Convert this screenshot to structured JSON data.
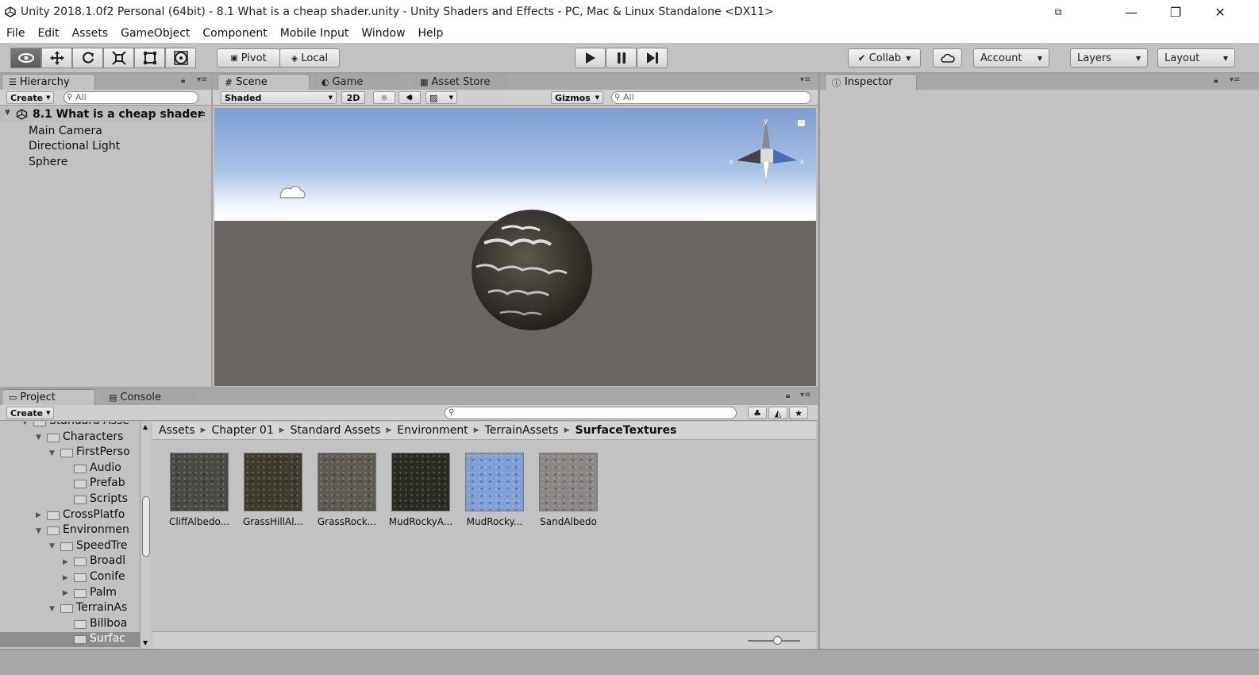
{
  "window": {
    "title": "Unity 2018.1.0f2 Personal (64bit) - 8.1 What is a cheap shader.unity - Unity Shaders and Effects - PC, Mac & Linux Standalone <DX11>",
    "minimize": "—",
    "maximize": "❐",
    "close": "✕"
  },
  "menu": [
    "File",
    "Edit",
    "Assets",
    "GameObject",
    "Component",
    "Mobile Input",
    "Window",
    "Help"
  ],
  "toolbar": {
    "pivot": "Pivot",
    "local": "Local",
    "collab": "Collab",
    "account": "Account",
    "layers": "Layers",
    "layout": "Layout"
  },
  "hierarchy": {
    "tab": "Hierarchy",
    "create": "Create",
    "search": "All",
    "scene": "8.1 What is a cheap shader",
    "items": [
      "Main Camera",
      "Directional Light",
      "Sphere"
    ]
  },
  "scene_panel": {
    "tabs": [
      "Scene",
      "Game",
      "Asset Store"
    ],
    "shading": "Shaded",
    "mode2d": "2D",
    "gizmos": "Gizmos",
    "search": "All",
    "gizmo_labels": {
      "x": "x",
      "y": "y",
      "z": "z"
    }
  },
  "inspector": {
    "tab": "Inspector"
  },
  "project": {
    "tabs": [
      "Project",
      "Console"
    ],
    "create": "Create",
    "tree": [
      {
        "label": "Standard Asse",
        "indent": 0,
        "open": true
      },
      {
        "label": "Characters",
        "indent": 1,
        "open": true
      },
      {
        "label": "FirstPerso",
        "indent": 2,
        "open": true
      },
      {
        "label": "Audio",
        "indent": 3,
        "open": null
      },
      {
        "label": "Prefab",
        "indent": 3,
        "open": null
      },
      {
        "label": "Scripts",
        "indent": 3,
        "open": null
      },
      {
        "label": "CrossPlatfo",
        "indent": 1,
        "open": false
      },
      {
        "label": "Environmen",
        "indent": 1,
        "open": true
      },
      {
        "label": "SpeedTre",
        "indent": 2,
        "open": true
      },
      {
        "label": "Broadl",
        "indent": 3,
        "open": false
      },
      {
        "label": "Conife",
        "indent": 3,
        "open": false
      },
      {
        "label": "Palm",
        "indent": 3,
        "open": false
      },
      {
        "label": "TerrainAs",
        "indent": 2,
        "open": true
      },
      {
        "label": "Billboa",
        "indent": 3,
        "open": null
      },
      {
        "label": "Surfac",
        "indent": 3,
        "open": null,
        "selected": true
      }
    ],
    "breadcrumb": [
      "Assets",
      "Chapter 01",
      "Standard Assets",
      "Environment",
      "TerrainAssets",
      "SurfaceTextures"
    ],
    "assets": [
      {
        "label": "CliffAlbedo...",
        "color": "#4a4a44"
      },
      {
        "label": "GrassHillAl...",
        "color": "#3e3a2e"
      },
      {
        "label": "GrassRock...",
        "color": "#5e5a52"
      },
      {
        "label": "MudRockyA...",
        "color": "#2a2a22"
      },
      {
        "label": "MudRocky...",
        "color": "#7f9fd6"
      },
      {
        "label": "SandAlbedo",
        "color": "#8a8684"
      }
    ]
  },
  "colors": {
    "panel": "#c2c2c2",
    "sky_top": "#7e9fd2",
    "ground": "#6a6560",
    "selection": "#8e8e8e"
  }
}
